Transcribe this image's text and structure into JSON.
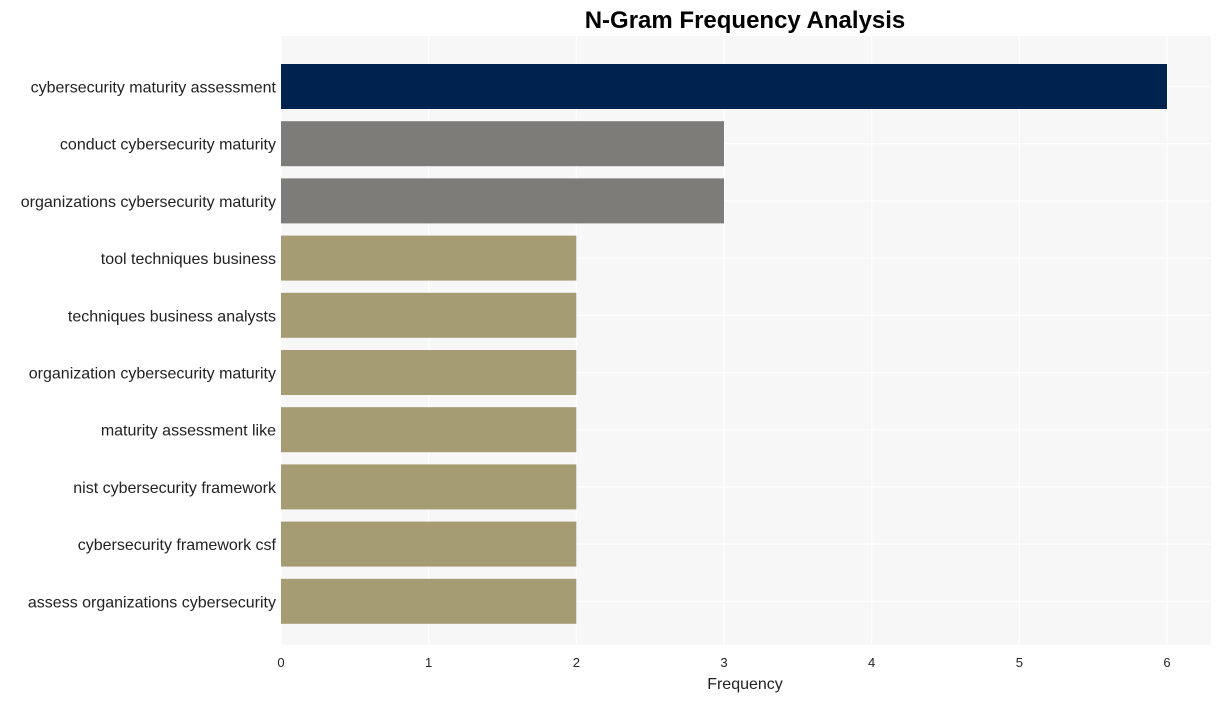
{
  "chart_data": {
    "type": "bar",
    "orientation": "horizontal",
    "title": "N-Gram Frequency Analysis",
    "xlabel": "Frequency",
    "ylabel": "",
    "xlim": [
      0,
      6.3
    ],
    "xticks": [
      0,
      1,
      2,
      3,
      4,
      5,
      6
    ],
    "grid": true,
    "legend": "none",
    "categories": [
      "cybersecurity maturity assessment",
      "conduct cybersecurity maturity",
      "organizations cybersecurity maturity",
      "tool techniques business",
      "techniques business analysts",
      "organization cybersecurity maturity",
      "maturity assessment like",
      "nist cybersecurity framework",
      "cybersecurity framework csf",
      "assess organizations cybersecurity"
    ],
    "values": [
      6,
      3,
      3,
      2,
      2,
      2,
      2,
      2,
      2,
      2
    ],
    "colors": [
      "#00224e",
      "#7d7c78",
      "#7d7c78",
      "#a59c74",
      "#a59c74",
      "#a59c74",
      "#a59c74",
      "#a59c74",
      "#a59c74",
      "#a59c74"
    ],
    "background": "#f7f7f7",
    "gridline_color": "#ffffff"
  }
}
